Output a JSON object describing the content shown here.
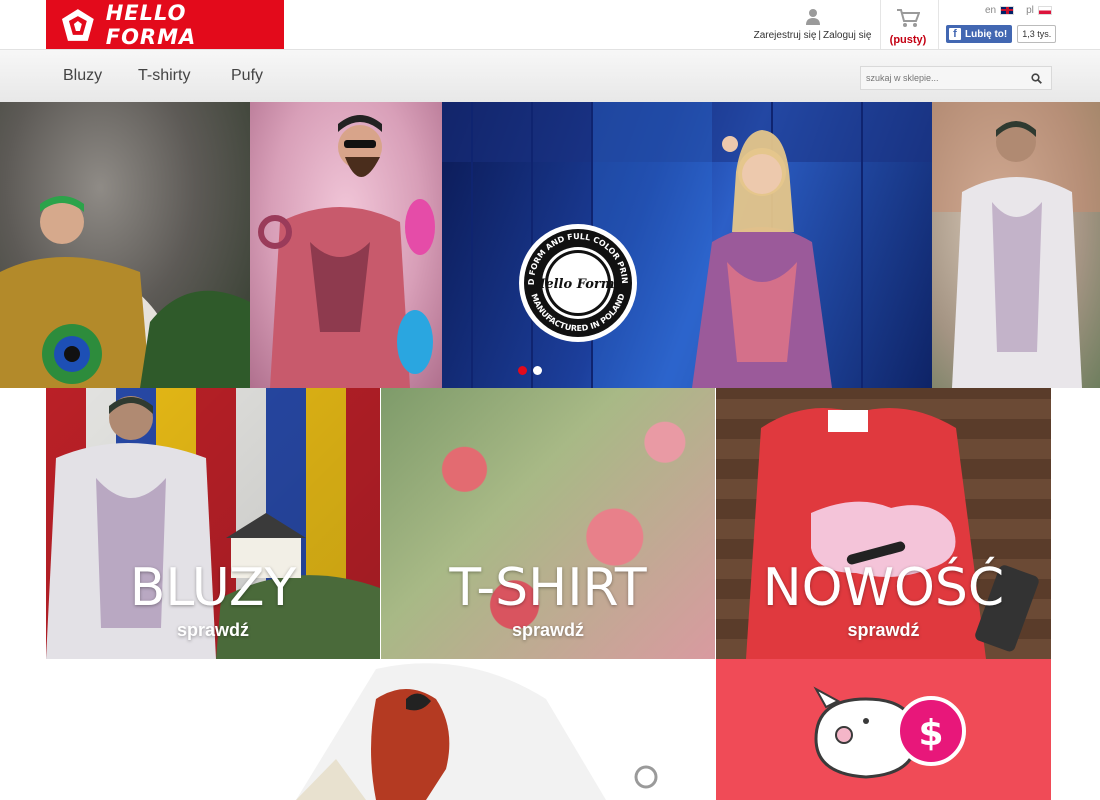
{
  "brand": {
    "logo_text": "HELLO FORMA",
    "color": "#e30a1b"
  },
  "account": {
    "register_label": "Zarejestruj się",
    "separator": "|",
    "login_label": "Zaloguj się"
  },
  "cart": {
    "status": "(pusty)"
  },
  "lang": {
    "en": "en",
    "pl": "pl"
  },
  "facebook": {
    "like_label": "Lubię to!",
    "count": "1,3 tys."
  },
  "nav": {
    "items": [
      "Bluzy",
      "T-shirty",
      "Pufy"
    ]
  },
  "search": {
    "placeholder": "szukaj w sklepie..."
  },
  "hero": {
    "badge_top": "GOOD FORM AND FULL COLOR PRINTING",
    "badge_center": "Hello Forma",
    "badge_bottom": "MANUFACTURED IN POLAND",
    "active_slide": 1,
    "slide_count": 2
  },
  "tiles": [
    {
      "title": "BLUZY",
      "subtitle": "sprawdź"
    },
    {
      "title": "T-SHIRT",
      "subtitle": "sprawdź"
    },
    {
      "title": "NOWOŚĆ",
      "subtitle": "sprawdź"
    }
  ],
  "colors": {
    "promo_pink": "#f04b57",
    "dot_active": "#e30a1b",
    "fb_blue": "#4267b2"
  }
}
